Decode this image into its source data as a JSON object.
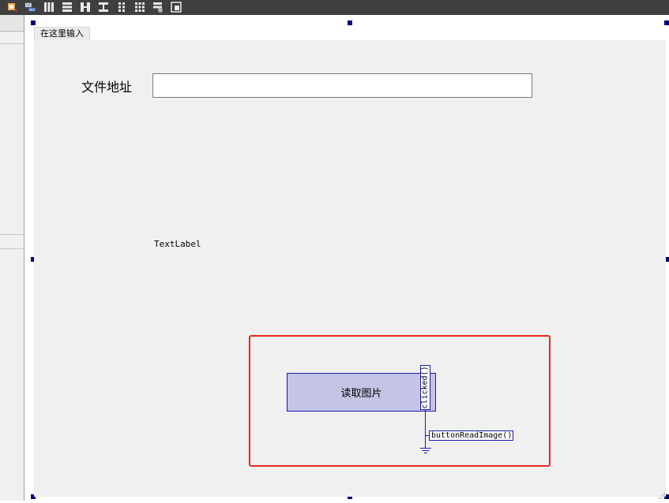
{
  "toolbar": {
    "icons": [
      "edit-widgets-icon",
      "edit-buddies-icon",
      "layout-horizontal-icon",
      "layout-vertical-icon",
      "split-horizontal-icon",
      "split-vertical-icon",
      "layout-form-icon",
      "layout-grid-icon",
      "break-layout-icon",
      "adjust-size-icon"
    ]
  },
  "menubar": {
    "placeholder_item": "在这里输入"
  },
  "form": {
    "file_label": "文件地址",
    "file_input_value": "",
    "text_label": "TextLabel",
    "read_button_label": "读取图片"
  },
  "connection": {
    "signal": "clicked()",
    "slot": "buttonReadImage()"
  },
  "colors": {
    "highlight_border": "#e8291c",
    "selection_handle": "#00007f",
    "connection_line": "#1a1ab0",
    "button_fill": "#c4c4e6",
    "canvas_bg": "#f0f0f0"
  }
}
